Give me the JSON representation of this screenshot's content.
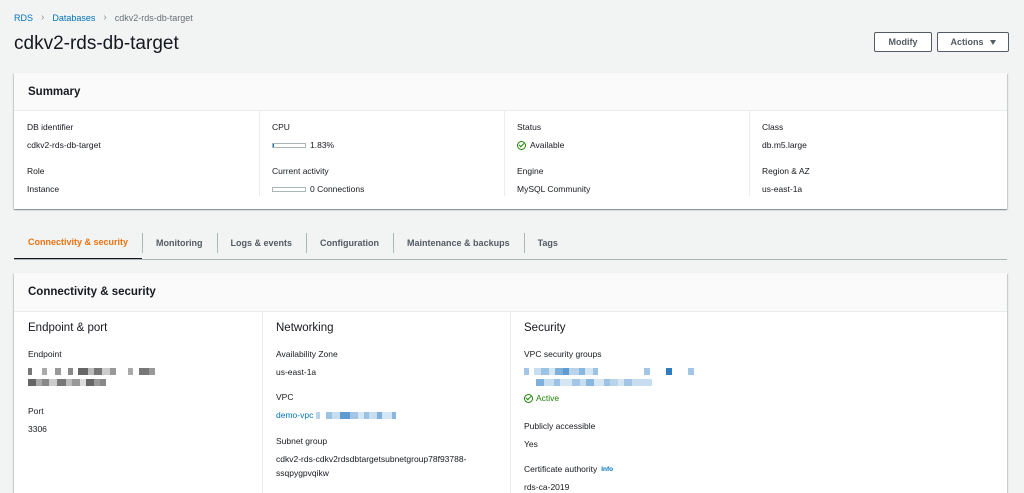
{
  "breadcrumb": {
    "items": [
      "RDS",
      "Databases"
    ],
    "current": "cdkv2-rds-db-target"
  },
  "header": {
    "title": "cdkv2-rds-db-target",
    "modify_label": "Modify",
    "actions_label": "Actions"
  },
  "summary": {
    "title": "Summary",
    "db_identifier_label": "DB identifier",
    "db_identifier": "cdkv2-rds-db-target",
    "role_label": "Role",
    "role": "Instance",
    "cpu_label": "CPU",
    "cpu_value": "1.83%",
    "cpu_fraction": 0.0183,
    "activity_label": "Current activity",
    "activity_value": "0 Connections",
    "activity_fraction": 0,
    "status_label": "Status",
    "status": "Available",
    "engine_label": "Engine",
    "engine": "MySQL Community",
    "class_label": "Class",
    "class": "db.m5.large",
    "region_label": "Region & AZ",
    "region": "us-east-1a"
  },
  "tabs": [
    {
      "label": "Connectivity & security",
      "active": true
    },
    {
      "label": "Monitoring",
      "active": false
    },
    {
      "label": "Logs & events",
      "active": false
    },
    {
      "label": "Configuration",
      "active": false
    },
    {
      "label": "Maintenance & backups",
      "active": false
    },
    {
      "label": "Tags",
      "active": false
    }
  ],
  "connectivity": {
    "title": "Connectivity & security",
    "endpoint_section": {
      "title": "Endpoint & port",
      "endpoint_label": "Endpoint",
      "port_label": "Port",
      "port": "3306"
    },
    "networking_section": {
      "title": "Networking",
      "az_label": "Availability Zone",
      "az": "us-east-1a",
      "vpc_label": "VPC",
      "vpc_link": "demo-vpc",
      "subnet_label": "Subnet group",
      "subnet_line1": "cdkv2-rds-cdkv2rdsdbtargetsubnetgroup78f93788-",
      "subnet_line2": "ssqpygpvqikw"
    },
    "security_section": {
      "title": "Security",
      "sg_label": "VPC security groups",
      "sg_status": "Active",
      "public_label": "Publicly accessible",
      "public": "Yes",
      "cert_label": "Certificate authority",
      "cert_info": "Info",
      "cert": "rds-ca-2019"
    }
  },
  "colors": {
    "accent": "#ec7211",
    "link": "#0073bb",
    "success": "#1d8102",
    "text": "#16191f"
  }
}
